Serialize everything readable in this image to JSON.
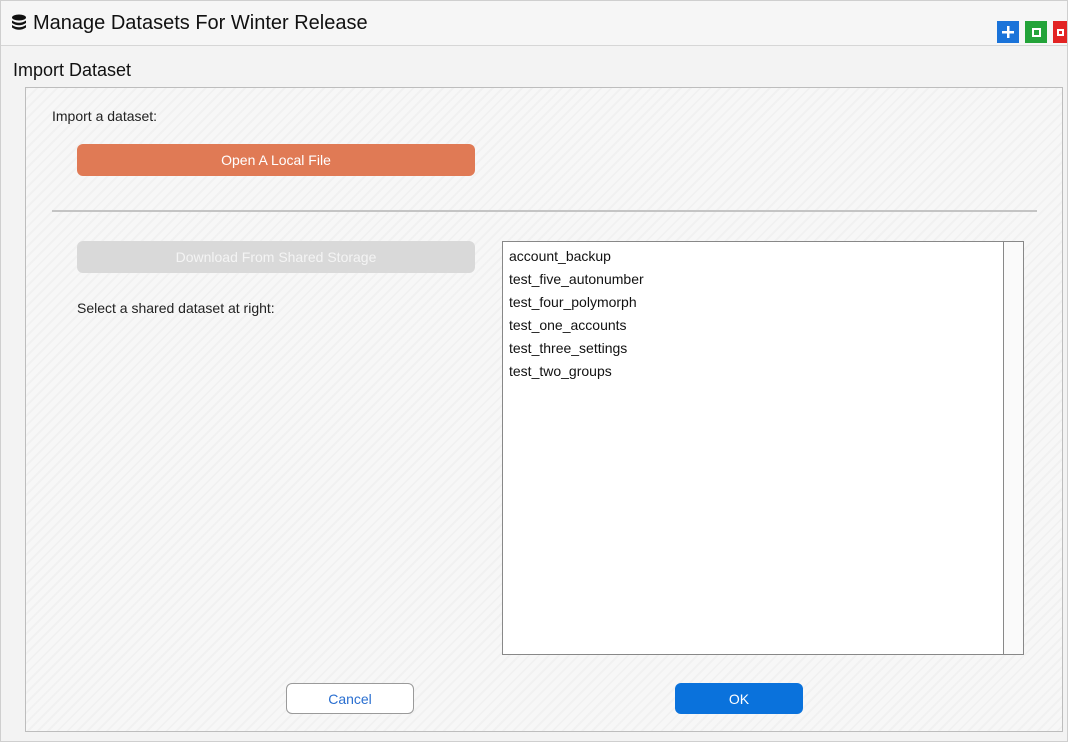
{
  "window": {
    "title": "Manage Datasets For Winter Release",
    "icon": "database-icon",
    "controls": [
      "add-icon",
      "maximize-icon",
      "close-icon"
    ],
    "colors": {
      "add": "#1a73d9",
      "maximize": "#23a339",
      "close": "#e22323"
    }
  },
  "section": {
    "title": "Import Dataset"
  },
  "import": {
    "label": "Import a dataset:",
    "open_local_button": "Open A Local File",
    "download_button": "Download From Shared Storage",
    "select_label": "Select a shared dataset at right:"
  },
  "datasets": {
    "items": [
      "account_backup",
      "test_five_autonumber",
      "test_four_polymorph",
      "test_one_accounts",
      "test_three_settings",
      "test_two_groups"
    ]
  },
  "footer": {
    "cancel_label": "Cancel",
    "ok_label": "OK"
  },
  "colors": {
    "open_button": "#e07a55",
    "ok_button": "#0a72dc",
    "disabled_button": "#d9d9d9"
  }
}
